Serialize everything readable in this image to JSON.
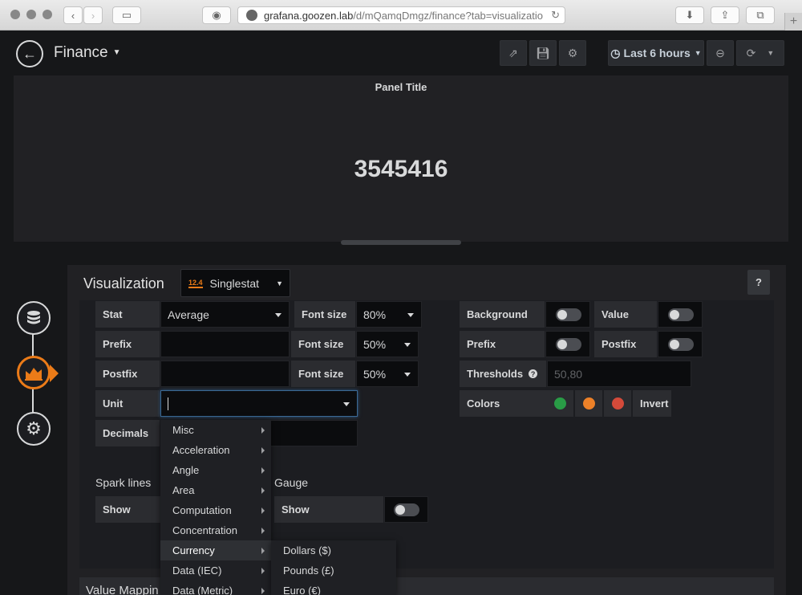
{
  "browser": {
    "url_host": "grafana.goozen.lab",
    "url_path": "/d/mQamqDmgz/finance?tab=visualizatio",
    "plus_label": "+"
  },
  "navbar": {
    "dashboard_title": "Finance",
    "time_range": "Last 6 hours"
  },
  "panel": {
    "title": "Panel Title",
    "value": "3545416"
  },
  "editor": {
    "heading": "Visualization",
    "viz_badge": "12.4",
    "viz_name": "Singlestat",
    "help": "?",
    "value_section": {
      "stat_label": "Stat",
      "stat_value": "Average",
      "prefix_label": "Prefix",
      "prefix_value": "",
      "postfix_label": "Postfix",
      "postfix_value": "",
      "unit_label": "Unit",
      "unit_value": "",
      "decimals_label": "Decimals"
    },
    "font_sizes": [
      {
        "label": "Font size",
        "value": "80%"
      },
      {
        "label": "Font size",
        "value": "50%"
      },
      {
        "label": "Font size",
        "value": "50%"
      }
    ],
    "coloring": {
      "background_label": "Background",
      "value_label": "Value",
      "prefix_label": "Prefix",
      "postfix_label": "Postfix",
      "thresholds_label": "Thresholds",
      "thresholds_value": "50,80",
      "colors_label": "Colors",
      "invert_label": "Invert",
      "color_swatches": [
        "#299c46",
        "#ed8128",
        "#d44a3a"
      ]
    },
    "sparklines": {
      "heading": "Spark lines",
      "show_label": "Show"
    },
    "gauge": {
      "heading": "Gauge",
      "show_label": "Show"
    },
    "value_mappings_heading": "Value Mappin"
  },
  "unit_menu": {
    "items": [
      "Misc",
      "Acceleration",
      "Angle",
      "Area",
      "Computation",
      "Concentration",
      "Currency",
      "Data (IEC)",
      "Data (Metric)"
    ],
    "active_index": 6
  },
  "currency_submenu": {
    "items": [
      "Dollars ($)",
      "Pounds (£)",
      "Euro (€)"
    ]
  }
}
